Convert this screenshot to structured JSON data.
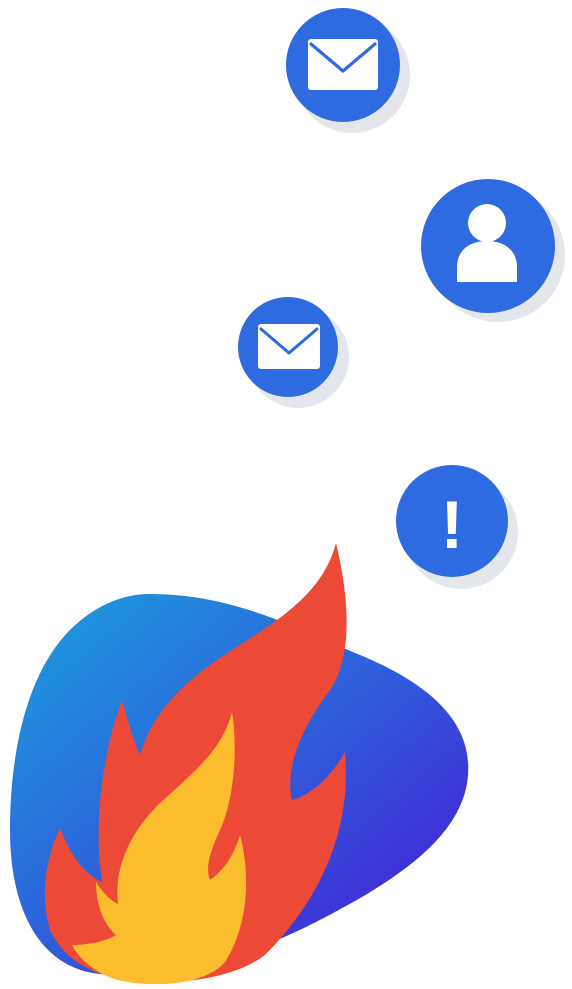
{
  "colors": {
    "bubble": "#2f6be0",
    "bubble_shadow": "#e3e7ec",
    "icon": "#ffffff",
    "blob_start": "#1aa0dd",
    "blob_mid": "#3157da",
    "blob_end": "#4a12d4",
    "flame_outer": "#ec4a37",
    "flame_inner": "#fbbd2d"
  },
  "bubbles": [
    {
      "icon": "envelope-icon"
    },
    {
      "icon": "user-icon"
    },
    {
      "icon": "envelope-icon"
    },
    {
      "icon": "exclamation-icon"
    }
  ],
  "alert": {
    "glyph": "!"
  },
  "illustration": {
    "icon": "flame-icon",
    "backdrop": "gradient-blob"
  }
}
